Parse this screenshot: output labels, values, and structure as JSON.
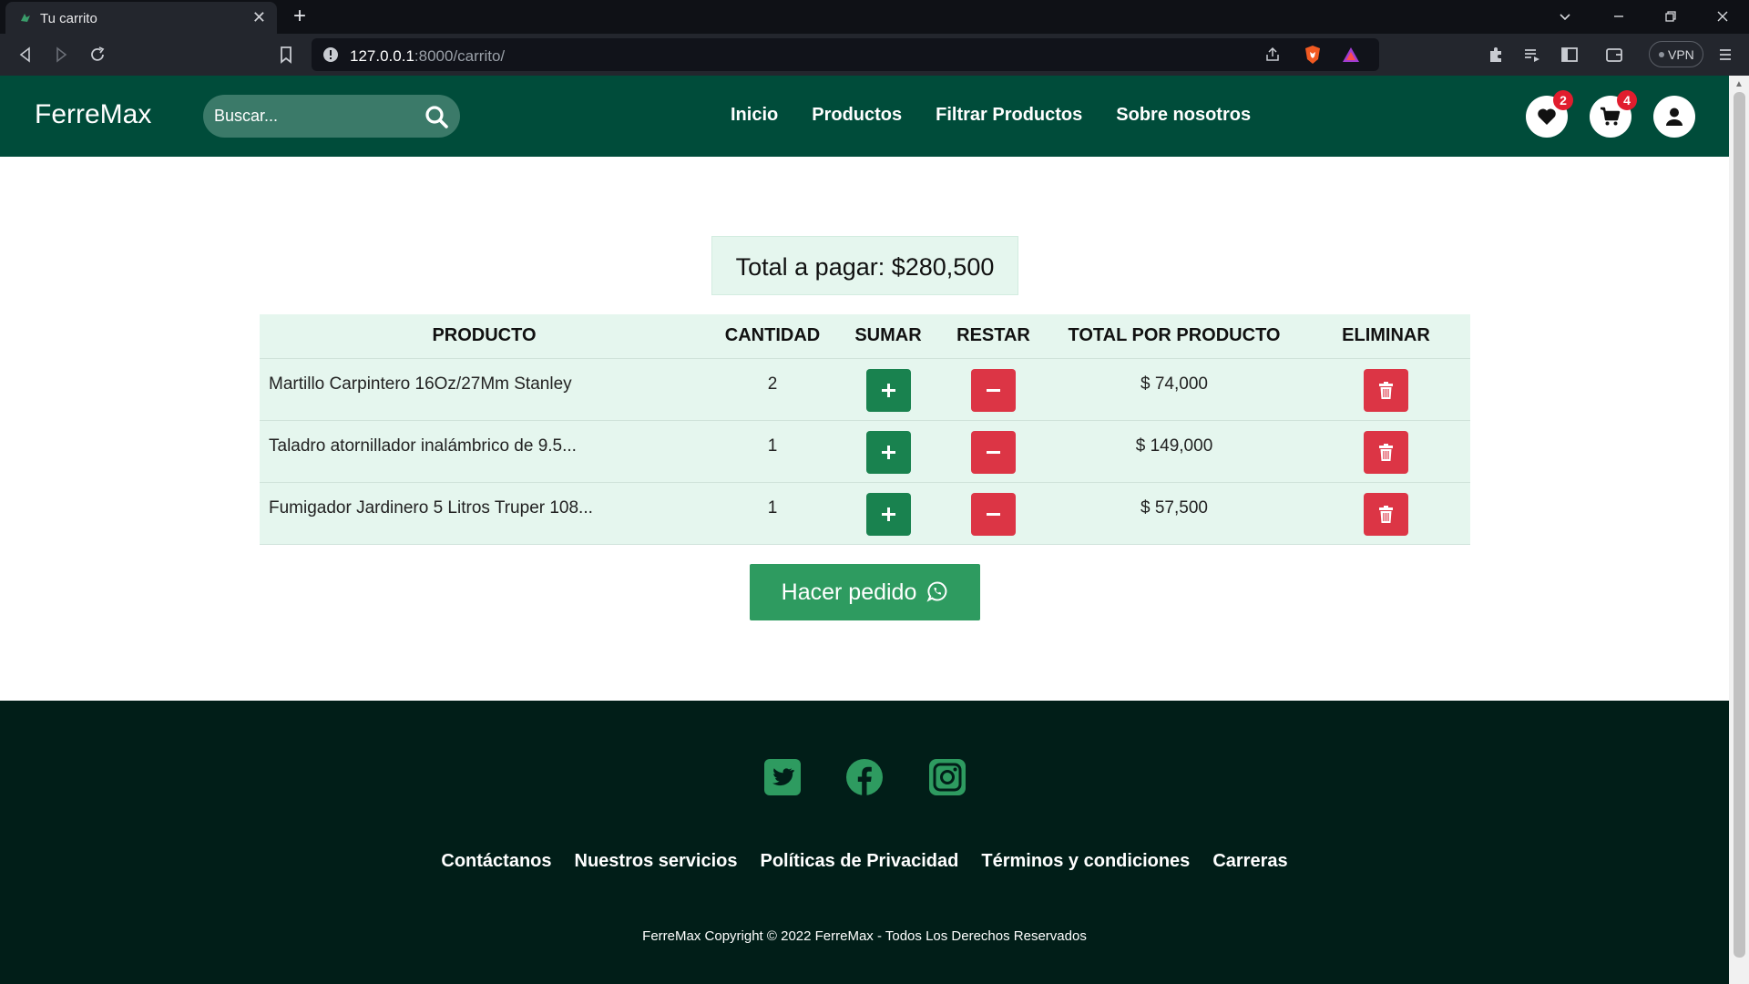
{
  "browser": {
    "tab_title": "Tu carrito",
    "tab_close": "✕",
    "new_tab": "+",
    "url_host": "127.0.0.1",
    "url_rest": ":8000/carrito/",
    "vpn_label": "VPN"
  },
  "header": {
    "logo": "FerreMax",
    "search_placeholder": "Buscar...",
    "nav": [
      "Inicio",
      "Productos",
      "Filtrar Productos",
      "Sobre nosotros"
    ],
    "wishlist_count": "2",
    "cart_count": "4"
  },
  "cart": {
    "total_label": "Total a pagar: $280,500",
    "columns": [
      "PRODUCTO",
      "CANTIDAD",
      "SUMAR",
      "RESTAR",
      "TOTAL POR PRODUCTO",
      "ELIMINAR"
    ],
    "rows": [
      {
        "product": "Martillo Carpintero 16Oz/27Mm Stanley",
        "quantity": "2",
        "total": "$ 74,000"
      },
      {
        "product": "Taladro atornillador inalámbrico de 9.5...",
        "quantity": "1",
        "total": "$ 149,000"
      },
      {
        "product": "Fumigador Jardinero 5 Litros Truper 108...",
        "quantity": "1",
        "total": "$ 57,500"
      }
    ],
    "order_button": "Hacer pedido"
  },
  "footer": {
    "links": [
      "Contáctanos",
      "Nuestros servicios",
      "Políticas de Privacidad",
      "Términos y condiciones",
      "Carreras"
    ],
    "copyright": "FerreMax Copyright © 2022 FerreMax - Todos Los Derechos Reservados"
  },
  "colors": {
    "header_bg": "#004c3a",
    "footer_bg": "#011e18",
    "table_bg": "#e5f6ee",
    "add_button": "#19824f",
    "danger_button": "#dc3545",
    "order_button": "#2e9b60",
    "social_icons": "#2e9b60"
  }
}
